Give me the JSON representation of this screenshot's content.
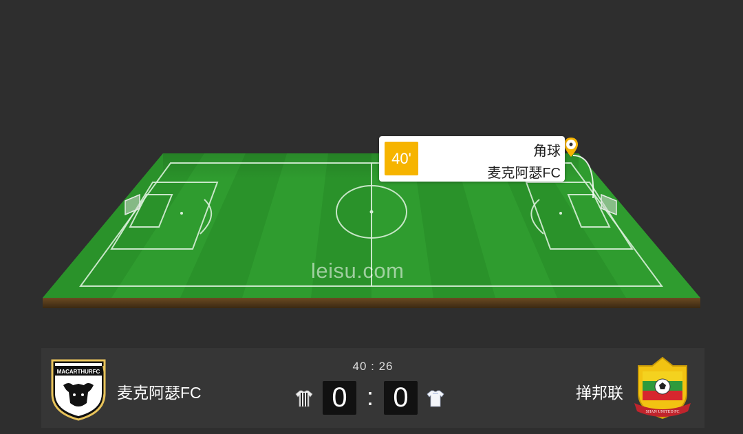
{
  "pitch": {
    "watermark": "leisu.com"
  },
  "event": {
    "minute": "40'",
    "type": "角球",
    "team": "麦克阿瑟FC"
  },
  "scoreboard": {
    "clock": "40 : 26",
    "home": {
      "name": "麦克阿瑟FC",
      "score": "0",
      "logo_text": "MACARTHURFC"
    },
    "separator": ":",
    "away": {
      "name": "掸邦联",
      "score": "0",
      "logo_text": "SHAN UNITED FC"
    }
  },
  "colors": {
    "background": "#2e2e2e",
    "pitch_green": "#2e9a2e",
    "event_accent": "#f6b400",
    "score_box": "#111111"
  }
}
